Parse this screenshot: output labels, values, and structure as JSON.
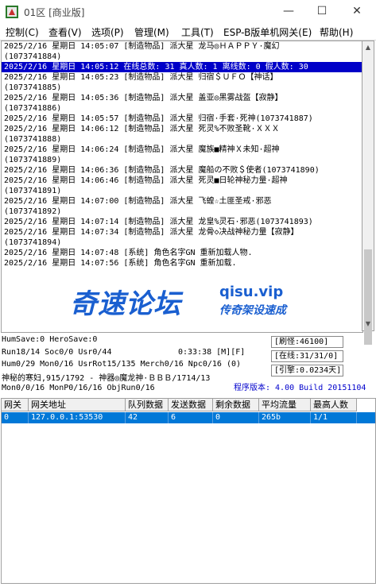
{
  "window": {
    "title": "01区 [商业版]",
    "minimize": "—",
    "maximize": "☐",
    "close": "✕"
  },
  "menu": [
    {
      "label": "控制(C)"
    },
    {
      "label": "查看(V)"
    },
    {
      "label": "选项(P)"
    },
    {
      "label": "管理(M)"
    },
    {
      "label": "工具(T)"
    },
    {
      "label": "ESP-B版单机网关(E)"
    },
    {
      "label": "帮助(H)"
    }
  ],
  "log": [
    {
      "text": "2025/2/16 星期日 14:05:07 [制造物品] 派大星 龙马◎ＨＡＰＰＹ·魔幻",
      "selected": false
    },
    {
      "text": "(1073741884)",
      "selected": false
    },
    {
      "text": "2025/2/16 星期日 14:05:12 在线总数: 31 真人数: 1 离线数: 0 假人数: 30",
      "selected": true
    },
    {
      "text": "2025/2/16 星期日 14:05:23 [制造物品] 派大星 归宿＄ＵＦＯ【神话】",
      "selected": false
    },
    {
      "text": "(1073741885)",
      "selected": false
    },
    {
      "text": "2025/2/16 星期日 14:05:36 [制造物品] 派大星 盖亚◎黑雾战盔【寂静】",
      "selected": false
    },
    {
      "text": "(1073741886)",
      "selected": false
    },
    {
      "text": "2025/2/16 星期日 14:05:57 [制造物品] 派大星 归宿·手套·死神(1073741887)",
      "selected": false
    },
    {
      "text": "2025/2/16 星期日 14:06:12 [制造物品] 派大星 死灵%不败圣靴·ＸＸＸ",
      "selected": false
    },
    {
      "text": "(1073741888)",
      "selected": false
    },
    {
      "text": "2025/2/16 星期日 14:06:24 [制造物品] 派大星 魔族■精神Ｘ未知·超神",
      "selected": false
    },
    {
      "text": "(1073741889)",
      "selected": false
    },
    {
      "text": "2025/2/16 星期日 14:06:36 [制造物品] 派大星 魔船の不败＄使者(1073741890)",
      "selected": false
    },
    {
      "text": "2025/2/16 星期日 14:06:46 [制造物品] 派大星 死灵■日轮神秘力量·超神",
      "selected": false
    },
    {
      "text": "(1073741891)",
      "selected": false
    },
    {
      "text": "2025/2/16 星期日 14:07:00 [制造物品] 派大星 飞蝗☆土匪圣戒·邪恶",
      "selected": false
    },
    {
      "text": "(1073741892)",
      "selected": false
    },
    {
      "text": "2025/2/16 星期日 14:07:14 [制造物品] 派大星 龙皇%灵石·邪恶(1073741893)",
      "selected": false
    },
    {
      "text": "2025/2/16 星期日 14:07:34 [制造物品] 派大星 龙骨◇决战神秘力量【寂静】",
      "selected": false
    },
    {
      "text": "(1073741894)",
      "selected": false
    },
    {
      "text": "2025/2/16 星期日 14:07:48 [系统] 角色名字GN 重新加载人物.",
      "selected": false
    },
    {
      "text": "2025/2/16 星期日 14:07:56 [系统] 角色名字GN 重新加载.",
      "selected": false
    }
  ],
  "watermark": {
    "big": "奇速论坛",
    "url": "qisu.vip",
    "sub": "传奇架设速成"
  },
  "status": {
    "line1": "HumSave:0 HeroSave:0",
    "line2": "Run18/14 Soc0/0 Usr0/44",
    "time": "0:33:38 [M][F]",
    "line3": "Hum0/29 Mon0/16 UsrRot15/135 Merch0/16 Npc0/16 (0)",
    "line4": "神秘的寒妇,915/1792 - 神器◎魔龙神·ＢＢＢ/1714/13",
    "line5": "Mon0/0/16 MonP0/16/16 ObjRun0/16",
    "refresh": "[刷怪:46100]",
    "online": "[在线:31/31/0]",
    "engine": "[引擎:0.0234天]",
    "version": "程序版本: 4.00 Build 20151104"
  },
  "grid": {
    "headers": [
      "网关",
      "网关地址",
      "队列数据",
      "发送数据",
      "剩余数据",
      "平均流量",
      "最高人数"
    ],
    "rows": [
      [
        "0",
        "127.0.0.1:53530",
        "42",
        "6",
        "0",
        "265b",
        "1/1"
      ]
    ]
  }
}
